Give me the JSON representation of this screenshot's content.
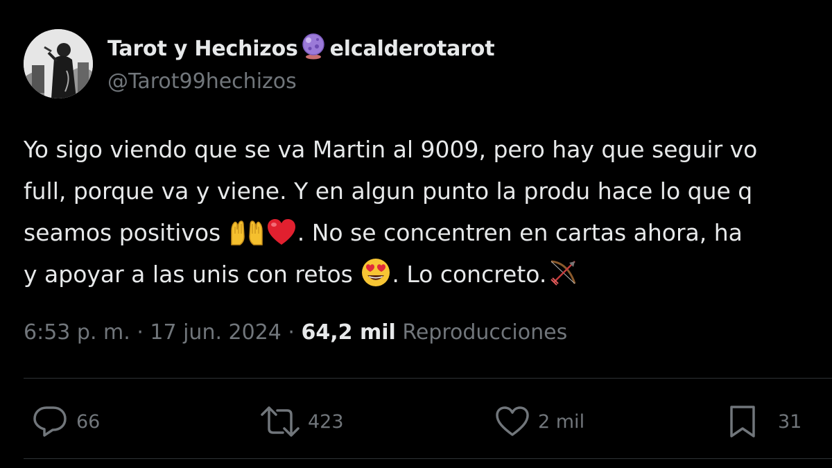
{
  "author": {
    "display_name_part1": "Tarot y Hechizos",
    "display_name_part2": "elcalderotarot",
    "handle": "@Tarot99hechizos",
    "avatar_icon": "avatar-image",
    "name_emoji": "crystal-ball-icon"
  },
  "tweet": {
    "line1": "Yo sigo viendo que se va Martin al 9009, pero hay que seguir vo",
    "line2": "full, porque va y viene. Y en algun punto la produ hace lo que q",
    "line3_a": "seamos positivos ",
    "line3_b": ". No se concentren en cartas ahora,  ha",
    "line4_a": "y apoyar a las unis con retos ",
    "line4_b": ". Lo concreto."
  },
  "meta": {
    "time": "6:53 p. m.",
    "sep1": " · ",
    "date": "17 jun. 2024",
    "sep2": " · ",
    "views_count": "64,2 mil",
    "views_label": " Reproducciones"
  },
  "actions": {
    "reply_count": "66",
    "retweet_count": "423",
    "like_count": "2 mil",
    "bookmark_count": "31"
  },
  "colors": {
    "background": "#000000",
    "primary_text": "#e7e9ea",
    "secondary_text": "#71767b",
    "divider": "#2f3336"
  }
}
